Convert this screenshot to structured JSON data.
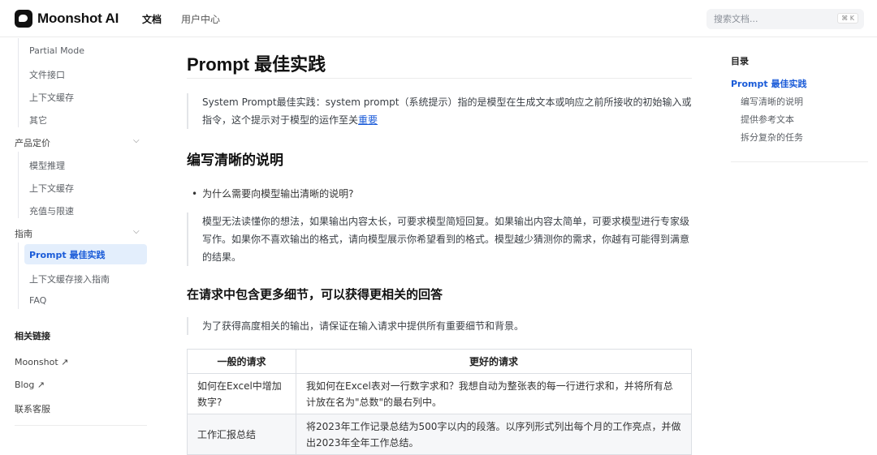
{
  "header": {
    "brand": "Moonshot AI",
    "nav": [
      "文档",
      "用户中心"
    ],
    "search_placeholder": "搜索文档...",
    "search_shortcut": "⌘ K"
  },
  "sidebar": {
    "items": [
      {
        "label": "Partial Mode",
        "type": "sub"
      },
      {
        "label": "文件接口",
        "type": "sub"
      },
      {
        "label": "上下文缓存",
        "type": "sub"
      },
      {
        "label": "其它",
        "type": "sub"
      },
      {
        "label": "产品定价",
        "type": "group"
      },
      {
        "label": "模型推理",
        "type": "sub"
      },
      {
        "label": "上下文缓存",
        "type": "sub"
      },
      {
        "label": "充值与限速",
        "type": "sub"
      },
      {
        "label": "指南",
        "type": "group"
      },
      {
        "label": "Prompt 最佳实践",
        "type": "active"
      },
      {
        "label": "上下文缓存接入指南",
        "type": "sub"
      },
      {
        "label": "FAQ",
        "type": "sub"
      }
    ],
    "links_heading": "相关链接",
    "links": [
      "Moonshot ↗",
      "Blog ↗",
      "联系客服"
    ]
  },
  "main": {
    "title": "Prompt 最佳实践",
    "intro_text": "System Prompt最佳实践：system prompt（系统提示）指的是模型在生成文本或响应之前所接收的初始输入或指令，这个提示对于模型的运作至关",
    "intro_link": "重要",
    "section1_title": "编写清晰的说明",
    "bullet": "为什么需要向模型输出清晰的说明?",
    "quote1": "模型无法读懂你的想法，如果输出内容太长，可要求模型简短回复。如果输出内容太简单，可要求模型进行专家级写作。如果你不喜欢输出的格式，请向模型展示你希望看到的格式。模型越少猜测你的需求，你越有可能得到满意的结果。",
    "section2_title": "在请求中包含更多细节，可以获得更相关的回答",
    "quote2": "为了获得高度相关的输出，请保证在输入请求中提供所有重要细节和背景。",
    "table": {
      "headers": [
        "一般的请求",
        "更好的请求"
      ],
      "rows": [
        [
          "如何在Excel中增加数字?",
          "我如何在Excel表对一行数字求和？我想自动为整张表的每一行进行求和，并将所有总计放在名为\"总数\"的最右列中。"
        ],
        [
          "工作汇报总结",
          "将2023年工作记录总结为500字以内的段落。以序列形式列出每个月的工作亮点，并做出2023年全年工作总结。"
        ]
      ]
    }
  },
  "toc": {
    "title": "目录",
    "items": [
      "Prompt 最佳实践",
      "编写清晰的说明",
      "提供参考文本",
      "拆分复杂的任务"
    ]
  }
}
